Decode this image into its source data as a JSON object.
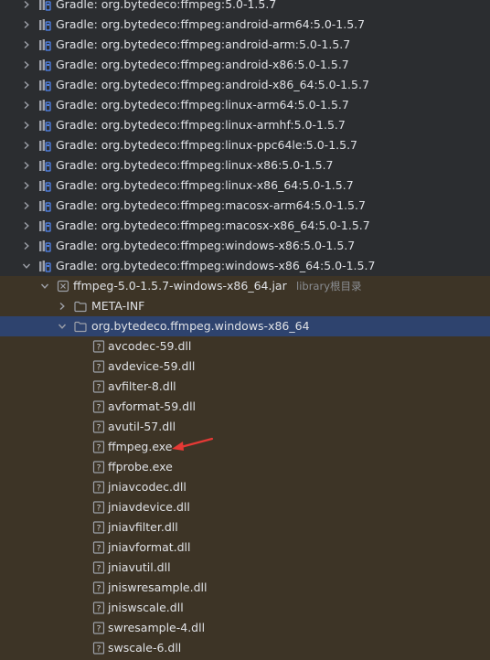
{
  "gradle_libs": [
    {
      "label": "Gradle: org.bytedeco:ffmpeg:5.0-1.5.7",
      "expanded": false
    },
    {
      "label": "Gradle: org.bytedeco:ffmpeg:android-arm64:5.0-1.5.7",
      "expanded": false
    },
    {
      "label": "Gradle: org.bytedeco:ffmpeg:android-arm:5.0-1.5.7",
      "expanded": false
    },
    {
      "label": "Gradle: org.bytedeco:ffmpeg:android-x86:5.0-1.5.7",
      "expanded": false
    },
    {
      "label": "Gradle: org.bytedeco:ffmpeg:android-x86_64:5.0-1.5.7",
      "expanded": false
    },
    {
      "label": "Gradle: org.bytedeco:ffmpeg:linux-arm64:5.0-1.5.7",
      "expanded": false
    },
    {
      "label": "Gradle: org.bytedeco:ffmpeg:linux-armhf:5.0-1.5.7",
      "expanded": false
    },
    {
      "label": "Gradle: org.bytedeco:ffmpeg:linux-ppc64le:5.0-1.5.7",
      "expanded": false
    },
    {
      "label": "Gradle: org.bytedeco:ffmpeg:linux-x86:5.0-1.5.7",
      "expanded": false
    },
    {
      "label": "Gradle: org.bytedeco:ffmpeg:linux-x86_64:5.0-1.5.7",
      "expanded": false
    },
    {
      "label": "Gradle: org.bytedeco:ffmpeg:macosx-arm64:5.0-1.5.7",
      "expanded": false
    },
    {
      "label": "Gradle: org.bytedeco:ffmpeg:macosx-x86_64:5.0-1.5.7",
      "expanded": false
    },
    {
      "label": "Gradle: org.bytedeco:ffmpeg:windows-x86:5.0-1.5.7",
      "expanded": false
    },
    {
      "label": "Gradle: org.bytedeco:ffmpeg:windows-x86_64:5.0-1.5.7",
      "expanded": true
    }
  ],
  "jar": {
    "label": "ffmpeg-5.0-1.5.7-windows-x86_64.jar",
    "hint": "library根目录"
  },
  "meta_inf": {
    "label": "META-INF"
  },
  "package": {
    "label": "org.bytedeco.ffmpeg.windows-x86_64"
  },
  "files": [
    "avcodec-59.dll",
    "avdevice-59.dll",
    "avfilter-8.dll",
    "avformat-59.dll",
    "avutil-57.dll",
    "ffmpeg.exe",
    "ffprobe.exe",
    "jniavcodec.dll",
    "jniavdevice.dll",
    "jniavfilter.dll",
    "jniavformat.dll",
    "jniavutil.dll",
    "jniswresample.dll",
    "jniswscale.dll",
    "swresample-4.dll",
    "swscale-6.dll"
  ],
  "icons": {
    "library": "library-icon",
    "jar": "jar-archive-icon",
    "folder": "folder-icon",
    "file": "unknown-file-icon",
    "chevron_right": "chevron-right-icon",
    "chevron_down": "chevron-down-icon",
    "annotation": "red-arrow-annotation"
  },
  "colors": {
    "background": "#2b2d30",
    "scope_background": "#3d3426",
    "selection": "#2e436e",
    "text": "#dfe1e5",
    "hint": "#8a8d92",
    "arrow": "#e53935"
  }
}
